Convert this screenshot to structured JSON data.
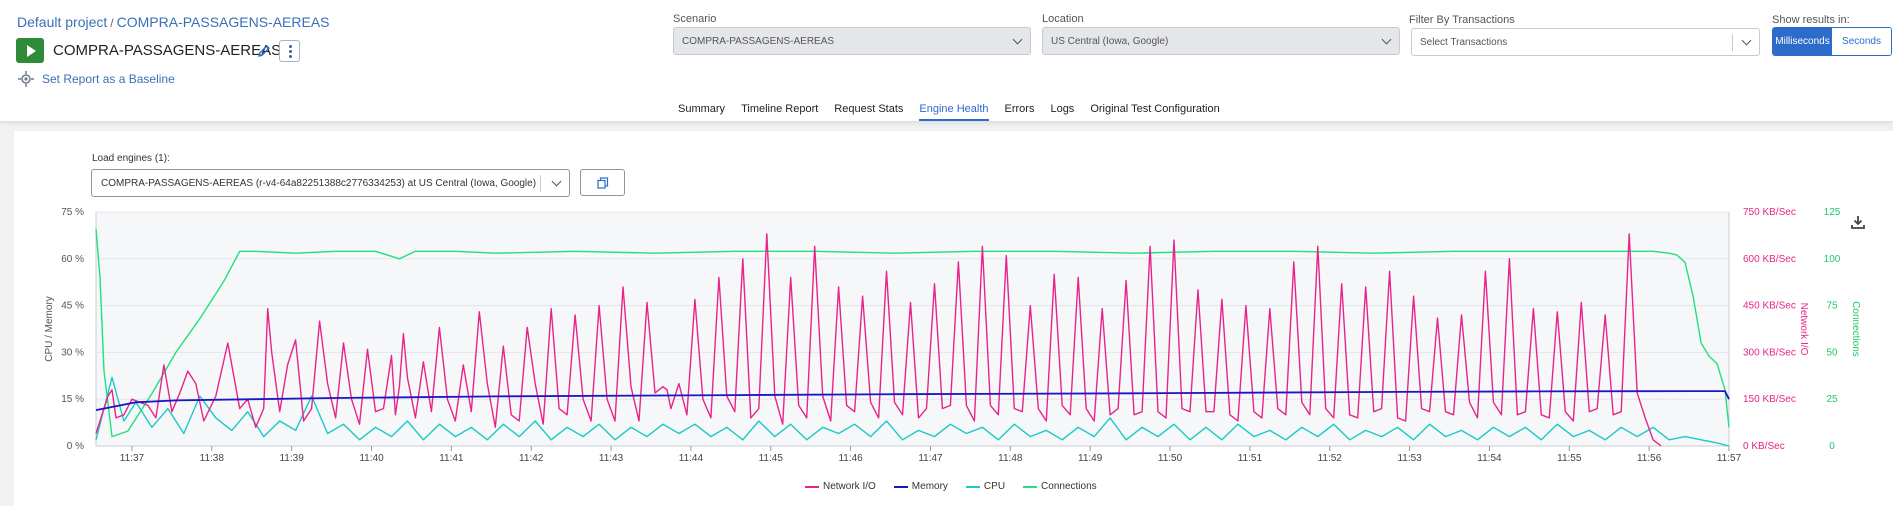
{
  "breadcrumb": {
    "project": "Default project",
    "separator": "/",
    "test": "COMPRA-PASSAGENS-AEREAS"
  },
  "test_name": "COMPRA-PASSAGENS-AEREAS",
  "baseline_link": "Set Report as a Baseline",
  "filters": {
    "scenario": {
      "label": "Scenario",
      "value": "COMPRA-PASSAGENS-AEREAS"
    },
    "location": {
      "label": "Location",
      "value": "US Central (Iowa, Google)"
    },
    "transactions": {
      "label": "Filter By Transactions",
      "placeholder": "Select Transactions"
    },
    "show_results": {
      "label": "Show results in:",
      "options": [
        "Milliseconds",
        "Seconds"
      ],
      "selected": "Milliseconds"
    }
  },
  "tabs": [
    "Summary",
    "Timeline Report",
    "Request Stats",
    "Engine Health",
    "Errors",
    "Logs",
    "Original Test Configuration"
  ],
  "active_tab": "Engine Health",
  "load_engines": {
    "label": "Load engines (1):",
    "value": "COMPRA-PASSAGENS-AEREAS (r-v4-64a82251388c2776334253) at US Central (Iowa, Google)"
  },
  "colors": {
    "accent": "#2d6cc9",
    "network": "#e8248a",
    "memory": "#1a16c4",
    "cpu": "#1ac9c9",
    "connections": "#22e07a"
  },
  "chart_data": {
    "type": "line",
    "xlabel": "",
    "x_ticks": [
      "11:37",
      "11:38",
      "11:39",
      "11:40",
      "11:41",
      "11:42",
      "11:43",
      "11:44",
      "11:45",
      "11:46",
      "11:47",
      "11:48",
      "11:49",
      "11:50",
      "11:51",
      "11:52",
      "11:53",
      "11:54",
      "11:55",
      "11:56",
      "11:57"
    ],
    "x_range": [
      "11:36:33",
      "11:57:00"
    ],
    "grid": true,
    "legend_placement": "bottom-center",
    "axes": {
      "left": {
        "label": "CPU / Memory",
        "ticks": [
          "0 %",
          "15 %",
          "30 %",
          "45 %",
          "60 %",
          "75 %"
        ],
        "ylim": [
          0,
          75
        ],
        "unit": "%"
      },
      "right1": {
        "label": "Network I/O",
        "ticks": [
          "0 KB/Sec",
          "150 KB/Sec",
          "300 KB/Sec",
          "450 KB/Sec",
          "600 KB/Sec",
          "750 KB/Sec"
        ],
        "ylim": [
          0,
          750
        ],
        "unit": "KB/Sec"
      },
      "right2": {
        "label": "Connections",
        "ticks": [
          "0",
          "25",
          "50",
          "75",
          "100",
          "125"
        ],
        "ylim": [
          0,
          125
        ]
      }
    },
    "series": [
      {
        "name": "Network I/O",
        "axis": "right1",
        "x_minutes": [
          0.0,
          0.1,
          0.15,
          0.2,
          0.25,
          0.35,
          0.45,
          0.55,
          0.65,
          0.75,
          0.85,
          0.95,
          1.05,
          1.15,
          1.25,
          1.35,
          1.5,
          1.65,
          1.8,
          1.9,
          2.0,
          2.1,
          2.15,
          2.2,
          2.3,
          2.4,
          2.5,
          2.6,
          2.7,
          2.8,
          2.9,
          3.0,
          3.1,
          3.2,
          3.3,
          3.4,
          3.5,
          3.6,
          3.7,
          3.75,
          3.8,
          3.85,
          3.9,
          4.0,
          4.1,
          4.2,
          4.3,
          4.4,
          4.5,
          4.6,
          4.7,
          4.8,
          4.9,
          5.0,
          5.1,
          5.2,
          5.3,
          5.4,
          5.5,
          5.6,
          5.7,
          5.8,
          5.9,
          6.0,
          6.1,
          6.2,
          6.3,
          6.4,
          6.5,
          6.6,
          6.7,
          6.8,
          6.9,
          7.0,
          7.05,
          7.1,
          7.15,
          7.2,
          7.3,
          7.4,
          7.5,
          7.6,
          7.7,
          7.8,
          7.9,
          8.0,
          8.1,
          8.2,
          8.3,
          8.4,
          8.5,
          8.6,
          8.7,
          8.8,
          8.9,
          9.0,
          9.1,
          9.2,
          9.3,
          9.4,
          9.5,
          9.6,
          9.7,
          9.8,
          9.9,
          10.0,
          10.1,
          10.2,
          10.3,
          10.4,
          10.5,
          10.6,
          10.7,
          10.8,
          10.9,
          11.0,
          11.1,
          11.2,
          11.3,
          11.4,
          11.5,
          11.6,
          11.7,
          11.8,
          11.9,
          12.0,
          12.1,
          12.2,
          12.3,
          12.4,
          12.5,
          12.6,
          12.7,
          12.8,
          12.9,
          13.0,
          13.1,
          13.2,
          13.3,
          13.4,
          13.5,
          13.6,
          13.7,
          13.8,
          13.9,
          14.0,
          14.1,
          14.2,
          14.3,
          14.4,
          14.5,
          14.6,
          14.7,
          14.8,
          14.9,
          15.0,
          15.1,
          15.2,
          15.3,
          15.4,
          15.5,
          15.6,
          15.7,
          15.8,
          15.9,
          16.0,
          16.1,
          16.2,
          16.3,
          16.4,
          16.5,
          16.6,
          16.7,
          16.8,
          16.9,
          17.0,
          17.1,
          17.2,
          17.3,
          17.4,
          17.5,
          17.6,
          17.7,
          17.8,
          17.9,
          18.0,
          18.1,
          18.2,
          18.3,
          18.4,
          18.5,
          18.6,
          18.7,
          18.8,
          18.9,
          19.0,
          19.1,
          19.2,
          19.3,
          19.4,
          19.5,
          19.6,
          19.7,
          19.8,
          19.9,
          20.0,
          20.1,
          20.2,
          20.3,
          20.4,
          20.45
        ],
        "values": [
          40,
          120,
          160,
          180,
          90,
          100,
          150,
          140,
          130,
          90,
          260,
          110,
          170,
          240,
          200,
          80,
          160,
          330,
          120,
          150,
          60,
          120,
          440,
          300,
          110,
          260,
          340,
          80,
          120,
          400,
          200,
          90,
          330,
          150,
          70,
          310,
          110,
          120,
          290,
          100,
          190,
          360,
          220,
          90,
          270,
          110,
          380,
          150,
          80,
          260,
          110,
          430,
          200,
          60,
          320,
          100,
          80,
          380,
          200,
          70,
          440,
          120,
          100,
          420,
          150,
          80,
          450,
          150,
          80,
          510,
          190,
          80,
          460,
          170,
          180,
          190,
          180,
          120,
          200,
          100,
          470,
          150,
          90,
          540,
          160,
          110,
          600,
          90,
          120,
          680,
          160,
          70,
          540,
          130,
          90,
          640,
          160,
          80,
          510,
          130,
          110,
          480,
          140,
          90,
          560,
          140,
          100,
          460,
          90,
          120,
          520,
          120,
          130,
          590,
          130,
          80,
          640,
          130,
          100,
          610,
          120,
          110,
          450,
          120,
          80,
          550,
          130,
          100,
          540,
          120,
          80,
          440,
          100,
          120,
          530,
          100,
          110,
          640,
          110,
          90,
          660,
          120,
          110,
          500,
          110,
          110,
          470,
          100,
          80,
          450,
          110,
          90,
          440,
          120,
          100,
          590,
          140,
          100,
          640,
          120,
          90,
          520,
          100,
          90,
          510,
          110,
          120,
          560,
          90,
          80,
          480,
          120,
          110,
          410,
          110,
          100,
          420,
          140,
          90,
          560,
          140,
          100,
          600,
          100,
          110,
          440,
          100,
          90,
          430,
          110,
          80,
          460,
          110,
          120,
          420,
          100,
          110,
          680,
          170,
          90,
          20,
          0
        ]
      },
      {
        "name": "Memory",
        "axis": "left",
        "x_minutes": [
          0.0,
          0.5,
          1.0,
          2.0,
          3.0,
          5.0,
          8.0,
          10.0,
          13.0,
          16.0,
          18.0,
          20.0,
          20.4,
          20.45
        ],
        "values": [
          11.5,
          14.0,
          14.6,
          15.0,
          15.4,
          15.9,
          16.3,
          16.6,
          16.9,
          17.3,
          17.5,
          17.6,
          17.6,
          15.0
        ]
      },
      {
        "name": "CPU",
        "axis": "left",
        "x_minutes": [
          0.0,
          0.2,
          0.35,
          0.5,
          0.7,
          0.9,
          1.1,
          1.3,
          1.5,
          1.7,
          1.9,
          2.1,
          2.3,
          2.5,
          2.7,
          2.9,
          3.1,
          3.3,
          3.5,
          3.7,
          3.9,
          4.1,
          4.3,
          4.5,
          4.7,
          4.9,
          5.1,
          5.3,
          5.5,
          5.7,
          5.9,
          6.1,
          6.3,
          6.5,
          6.7,
          6.9,
          7.1,
          7.3,
          7.5,
          7.7,
          7.9,
          8.1,
          8.3,
          8.5,
          8.7,
          8.9,
          9.1,
          9.3,
          9.5,
          9.7,
          9.9,
          10.1,
          10.3,
          10.5,
          10.7,
          10.9,
          11.1,
          11.3,
          11.5,
          11.7,
          11.9,
          12.1,
          12.3,
          12.5,
          12.7,
          12.9,
          13.1,
          13.3,
          13.5,
          13.7,
          13.9,
          14.1,
          14.3,
          14.5,
          14.7,
          14.9,
          15.1,
          15.3,
          15.5,
          15.7,
          15.9,
          16.1,
          16.3,
          16.5,
          16.7,
          16.9,
          17.1,
          17.3,
          17.5,
          17.7,
          17.9,
          18.1,
          18.3,
          18.5,
          18.7,
          18.9,
          19.1,
          19.3,
          19.5,
          19.7,
          19.9,
          20.1,
          20.3,
          20.45
        ],
        "values": [
          2,
          22,
          8,
          14,
          6,
          12,
          4,
          16,
          9,
          5,
          11,
          3,
          8,
          5,
          16,
          4,
          7,
          2,
          6,
          3,
          8,
          2,
          7,
          3,
          6,
          2,
          7,
          3,
          8,
          2,
          6,
          3,
          7,
          2,
          6,
          3,
          7,
          4,
          7,
          3,
          6,
          2,
          8,
          3,
          7,
          2,
          6,
          4,
          7,
          3,
          8,
          2,
          5,
          3,
          7,
          4,
          6,
          2,
          7,
          3,
          5,
          2,
          6,
          3,
          9,
          2,
          6,
          3,
          7,
          2,
          6,
          2,
          7,
          3,
          5,
          2,
          6,
          3,
          7,
          2,
          5,
          3,
          6,
          2,
          7,
          3,
          5,
          2,
          6,
          3,
          6,
          2,
          7,
          3,
          5,
          2,
          6,
          3,
          6,
          2,
          3,
          2,
          1,
          0
        ]
      },
      {
        "name": "Connections",
        "axis": "right2",
        "x_minutes": [
          0.0,
          0.05,
          0.1,
          0.2,
          0.4,
          0.7,
          1.0,
          1.3,
          1.6,
          1.8,
          2.0,
          2.5,
          3.0,
          3.5,
          3.8,
          4.0,
          4.5,
          5.0,
          6.0,
          7.0,
          8.0,
          9.0,
          10.0,
          11.0,
          12.0,
          13.0,
          14.0,
          15.0,
          16.0,
          17.0,
          18.0,
          19.0,
          19.5,
          19.7,
          19.8,
          19.9,
          20.0,
          20.1,
          20.2,
          20.3,
          20.4,
          20.45
        ],
        "values": [
          116,
          90,
          40,
          5,
          8,
          28,
          50,
          68,
          88,
          104,
          104,
          103,
          104,
          104,
          100,
          104,
          104,
          103,
          104,
          103,
          104,
          104,
          103,
          104,
          104,
          103,
          104,
          104,
          103,
          104,
          104,
          104,
          104,
          103,
          102,
          98,
          80,
          55,
          48,
          44,
          30,
          10
        ]
      }
    ]
  }
}
